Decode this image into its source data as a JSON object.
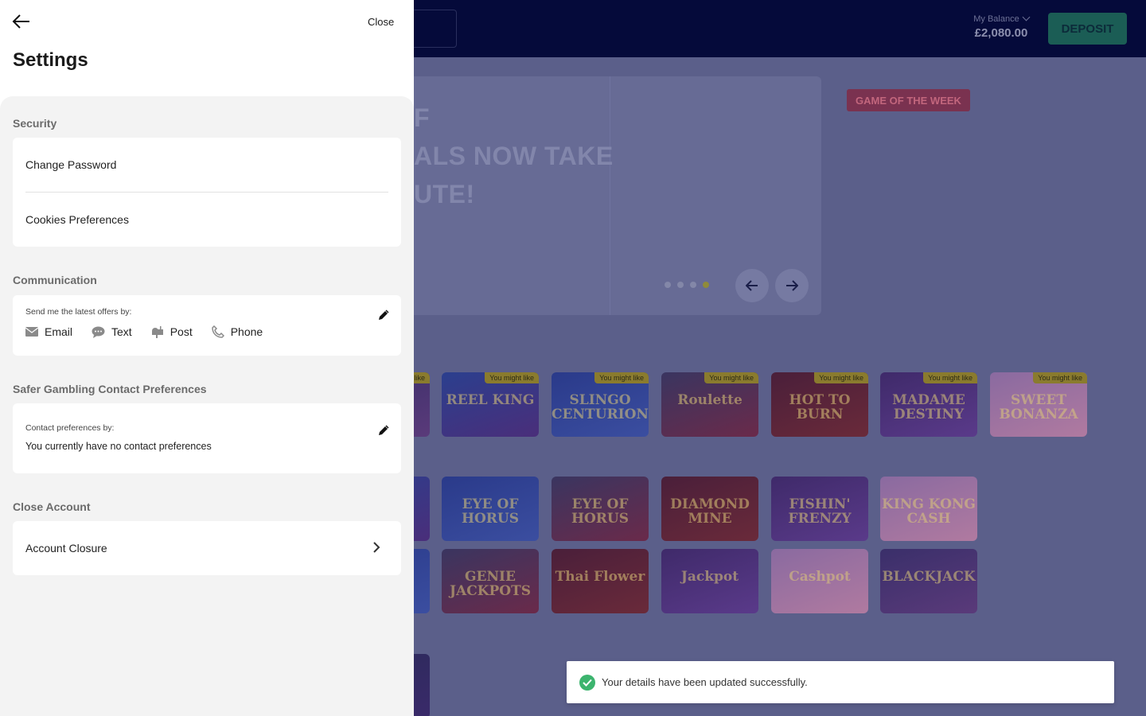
{
  "header": {
    "balance_label": "My Balance",
    "balance_value": "£2,080.00",
    "deposit_label": "DEPOSIT"
  },
  "hero": {
    "lines": [
      "F",
      "ALS NOW TAKE",
      "UTE!"
    ],
    "dot_count": 4,
    "active_dot": 4
  },
  "game_of_week_label": "GAME OF THE WEEK",
  "tiles": {
    "badge": "You might like",
    "row1": [
      "",
      "REEL KING",
      "SLINGO CENTURION",
      "Roulette",
      "HOT TO BURN",
      "MADAME DESTINY",
      "SWEET BONANZA"
    ],
    "row2": [
      "",
      "EYE OF HORUS",
      "EYE OF HORUS",
      "DIAMOND MINE",
      "FISHIN' FRENZY",
      "KING KONG CASH"
    ],
    "row3": [
      "",
      "GENIE JACKPOTS",
      "Thai Flower",
      "Jackpot",
      "Cashpot",
      "BLACKJACK"
    ]
  },
  "settings": {
    "close_label": "Close",
    "title": "Settings",
    "security": {
      "heading": "Security",
      "items": [
        "Change Password",
        "Cookies Preferences"
      ]
    },
    "communication": {
      "heading": "Communication",
      "label": "Send me the latest offers by:",
      "channels": [
        "Email",
        "Text",
        "Post",
        "Phone"
      ]
    },
    "safer_gambling": {
      "heading": "Safer Gambling Contact Preferences",
      "label": "Contact preferences by:",
      "value": "You currently have no contact preferences"
    },
    "close_account": {
      "heading": "Close Account",
      "item": "Account Closure"
    }
  },
  "toast": {
    "message": "Your details have been updated successfully."
  },
  "colors": {
    "header_bg": "#050a3a",
    "overlay_bg": "#5b5f8a",
    "deposit": "#1b5d55",
    "success": "#3cb46e"
  }
}
